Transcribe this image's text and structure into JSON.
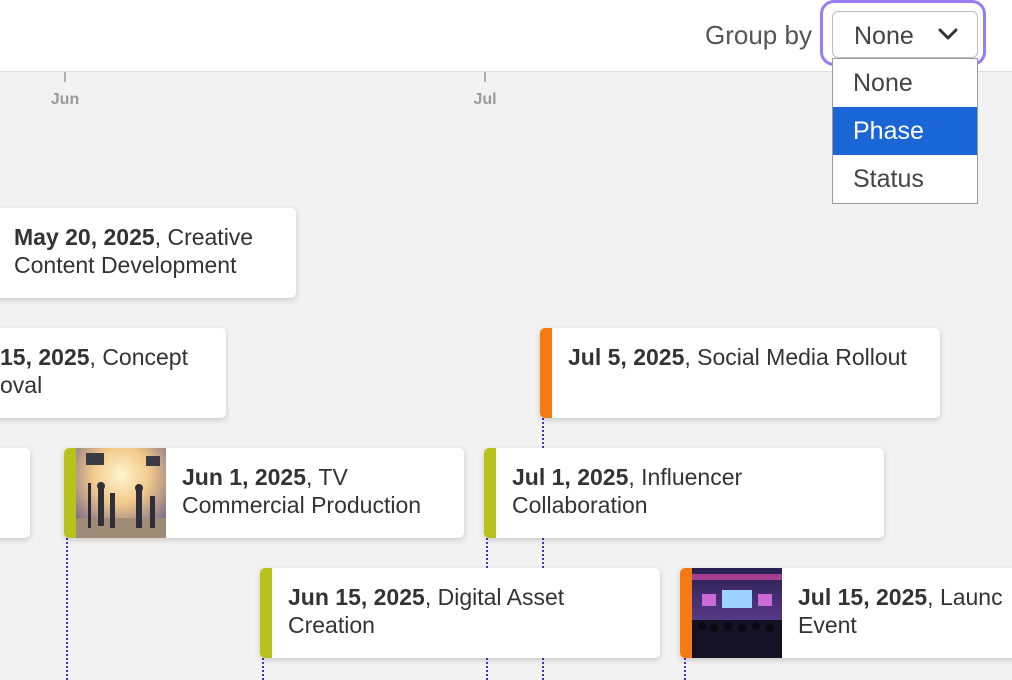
{
  "toolbar": {
    "group_by_label": "Group by",
    "select_value": "None",
    "options": [
      "None",
      "Phase",
      "Status"
    ],
    "selected_option_index": 1
  },
  "axis": {
    "ticks": [
      "Jun",
      "Jul"
    ]
  },
  "events": [
    {
      "date": "May 20, 2025",
      "title": "Creative Content Development",
      "line1": "Creative",
      "line2": "Content Development"
    },
    {
      "date": "15, 2025",
      "title": "Concept",
      "line2": "oval"
    },
    {
      "date": "Jul 5, 2025",
      "title": "Social Media Rollout",
      "accent": "#f47b12"
    },
    {
      "date": "Jun 1, 2025",
      "title": "TV Commercial Production",
      "line1": "TV",
      "line2": "Commercial Production",
      "accent": "#b7c21c",
      "image": "film-set-photo"
    },
    {
      "date": "Jul 1, 2025",
      "title": "Influencer Collaboration",
      "line1": "Influencer",
      "line2": "Collaboration",
      "accent": "#b7c21c"
    },
    {
      "date": "Jun 15, 2025",
      "title": "Digital Asset Creation",
      "line1": "Digital Asset",
      "line2": "Creation",
      "accent": "#b7c21c"
    },
    {
      "date": "Jul 15, 2025",
      "title": "Launc",
      "line2": "Event",
      "accent": "#f47b12",
      "image": "launch-event-photo"
    }
  ],
  "colors": {
    "focus_ring": "#9a7cf2",
    "selected_option": "#1a66d6",
    "connector": "#5a2db8",
    "phase_green": "#b7c21c",
    "phase_orange": "#f47b12"
  }
}
